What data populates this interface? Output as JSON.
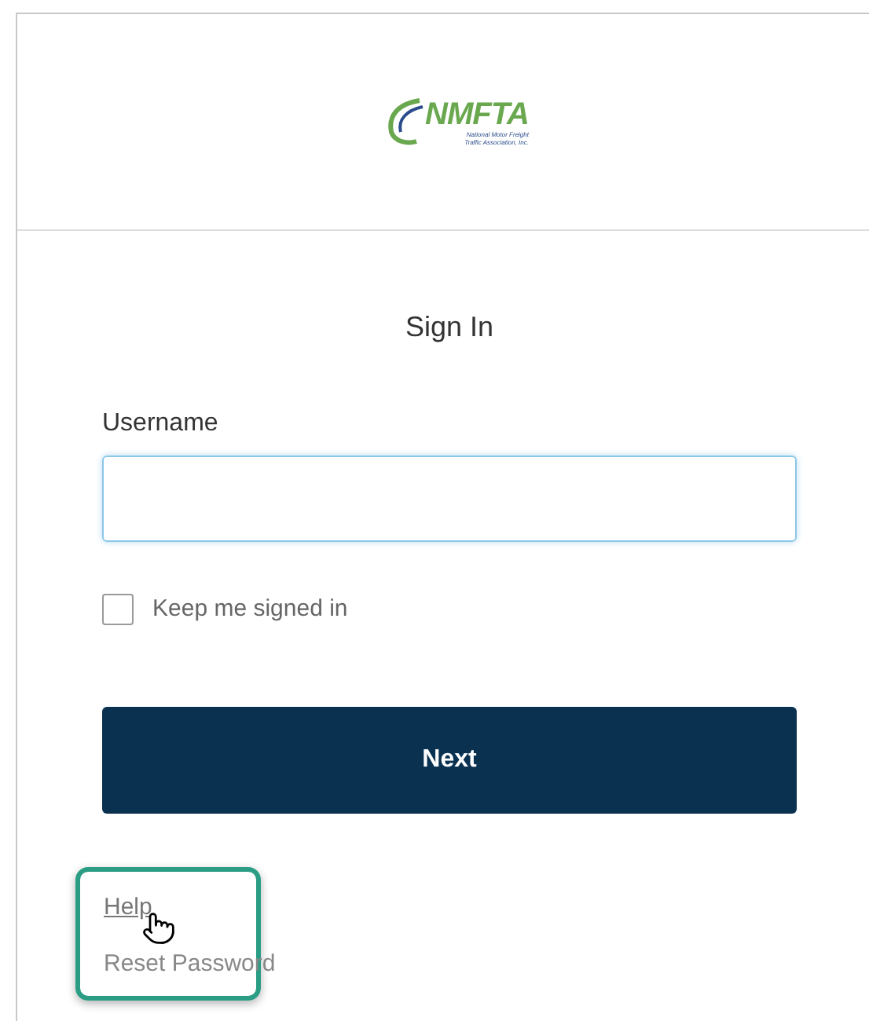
{
  "logo": {
    "wordmark": "NMFTA",
    "tagline_lines": [
      "National Motor Freight",
      "Traffic Association, Inc."
    ]
  },
  "title": "Sign In",
  "username": {
    "label": "Username"
  },
  "keep_signed_in": {
    "label": "Keep me signed in",
    "checked": false
  },
  "next_button": "Next",
  "links": [
    "Help",
    "Reset Password"
  ]
}
